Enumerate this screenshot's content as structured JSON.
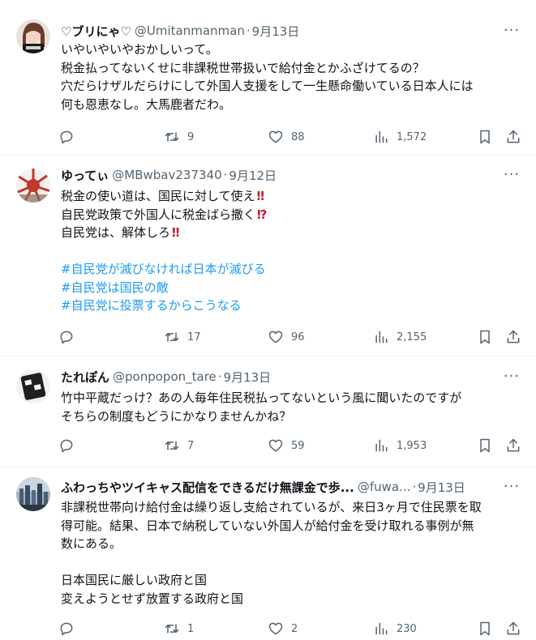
{
  "tweets": [
    {
      "name": "♡ブリにゃ♡",
      "handle": "@Umitanmanman",
      "date": "9月13日",
      "avatar_color": "#7a4a3a",
      "lines": [
        "いやいやいやおかしいって。",
        "税金払ってないくせに非課税世帯扱いで給付金とかふざけてるの？",
        "穴だらけザルだらけにして外国人支援をして一生懸命働いている日本人には",
        "何も恩恵なし。大馬鹿者だわ。"
      ],
      "replies": "",
      "retweets": "9",
      "likes": "88",
      "views": "1,572"
    },
    {
      "name": "ゆってぃ",
      "handle": "@MBwbav237340",
      "date": "9月12日",
      "avatar_color": "#c0392b",
      "lines": [
        "税金の使い道は、国民に対して使え",
        "自民党政策で外国人に税金ばら撒く",
        "自民党は、解体しろ"
      ],
      "emphasis": [
        "‼",
        "⁉",
        "‼"
      ],
      "hashtags": [
        "#自民党が滅びなければ日本が滅びる",
        "#自民党は国民の敵",
        "#自民党に投票するからこうなる"
      ],
      "replies": "",
      "retweets": "17",
      "likes": "96",
      "views": "2,155"
    },
    {
      "name": "たれぽん",
      "handle": "@ponpopon_tare",
      "date": "9月13日",
      "avatar_color": "#222222",
      "lines": [
        "竹中平蔵だっけ？あの人毎年住民税払ってないという風に聞いたのですが",
        "そちらの制度もどうにかなりませんかね？"
      ],
      "replies": "",
      "retweets": "7",
      "likes": "59",
      "views": "1,953"
    },
    {
      "name": "ふわっちやツイキャス配信をできるだけ無課金で歩...",
      "handle": "@fuwa...",
      "date": "9月13日",
      "avatar_color": "#5d7288",
      "lines": [
        "非課税世帯向け給付金は繰り返し支給されているが、来日3ヶ月で住民票を取",
        "得可能。結果、日本で納税していない外国人が給付金を受け取れる事例が無",
        "数にある。",
        "",
        "日本国民に厳しい政府と国",
        "変えようとせず放置する政府と国"
      ],
      "replies": "",
      "retweets": "1",
      "likes": "2",
      "views": "230"
    }
  ],
  "ui": {
    "more": "···",
    "dot": "·"
  }
}
